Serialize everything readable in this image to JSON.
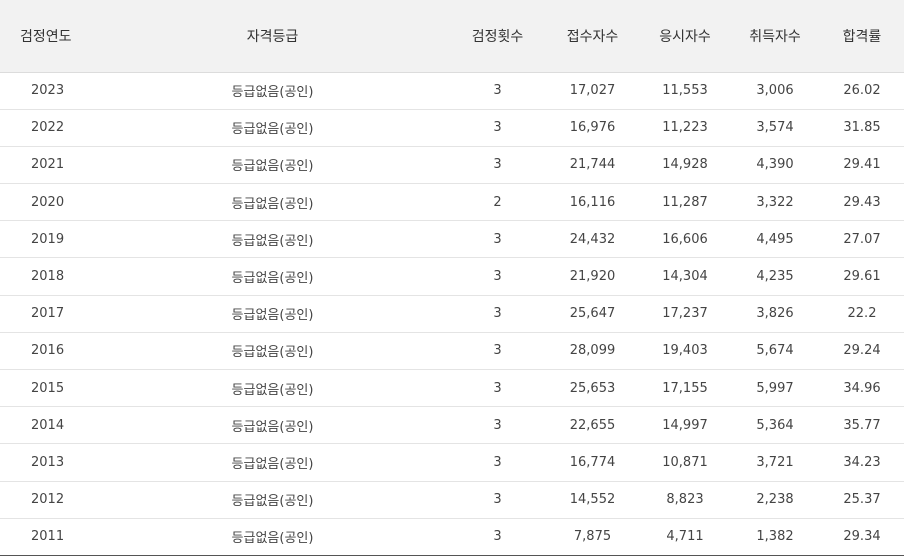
{
  "table": {
    "headers": [
      "검정연도",
      "자격등급",
      "검정횟수",
      "접수자수",
      "응시자수",
      "취득자수",
      "합격률"
    ],
    "rows": [
      [
        "2023",
        "등급없음(공인)",
        "3",
        "17,027",
        "11,553",
        "3,006",
        "26.02"
      ],
      [
        "2022",
        "등급없음(공인)",
        "3",
        "16,976",
        "11,223",
        "3,574",
        "31.85"
      ],
      [
        "2021",
        "등급없음(공인)",
        "3",
        "21,744",
        "14,928",
        "4,390",
        "29.41"
      ],
      [
        "2020",
        "등급없음(공인)",
        "2",
        "16,116",
        "11,287",
        "3,322",
        "29.43"
      ],
      [
        "2019",
        "등급없음(공인)",
        "3",
        "24,432",
        "16,606",
        "4,495",
        "27.07"
      ],
      [
        "2018",
        "등급없음(공인)",
        "3",
        "21,920",
        "14,304",
        "4,235",
        "29.61"
      ],
      [
        "2017",
        "등급없음(공인)",
        "3",
        "25,647",
        "17,237",
        "3,826",
        "22.2"
      ],
      [
        "2016",
        "등급없음(공인)",
        "3",
        "28,099",
        "19,403",
        "5,674",
        "29.24"
      ],
      [
        "2015",
        "등급없음(공인)",
        "3",
        "25,653",
        "17,155",
        "5,997",
        "34.96"
      ],
      [
        "2014",
        "등급없음(공인)",
        "3",
        "22,655",
        "14,997",
        "5,364",
        "35.77"
      ],
      [
        "2013",
        "등급없음(공인)",
        "3",
        "16,774",
        "10,871",
        "3,721",
        "34.23"
      ],
      [
        "2012",
        "등급없음(공인)",
        "3",
        "14,552",
        "8,823",
        "2,238",
        "25.37"
      ],
      [
        "2011",
        "등급없음(공인)",
        "3",
        "7,875",
        "4,711",
        "1,382",
        "29.34"
      ]
    ]
  }
}
